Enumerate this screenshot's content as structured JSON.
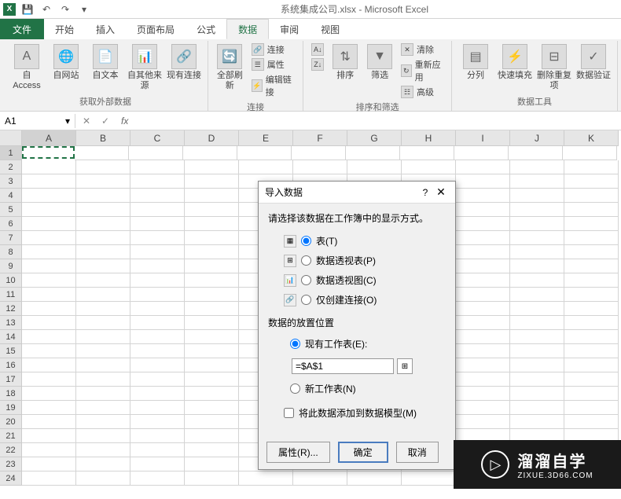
{
  "app": {
    "title": "系统集成公司.xlsx - Microsoft Excel"
  },
  "tabs": {
    "file": "文件",
    "home": "开始",
    "insert": "插入",
    "pagelayout": "页面布局",
    "formulas": "公式",
    "data": "数据",
    "review": "审阅",
    "view": "视图"
  },
  "ribbon": {
    "get_external": {
      "access": "自 Access",
      "web": "自网站",
      "text": "自文本",
      "other": "自其他来源",
      "existing": "现有连接",
      "label": "获取外部数据"
    },
    "connections": {
      "refresh": "全部刷新",
      "conn": "连接",
      "properties": "属性",
      "edit_links": "编辑链接",
      "label": "连接"
    },
    "sort_filter": {
      "sort": "排序",
      "filter": "筛选",
      "clear": "清除",
      "reapply": "重新应用",
      "advanced": "高级",
      "label": "排序和筛选"
    },
    "data_tools": {
      "text_to_col": "分列",
      "flash_fill": "快速填充",
      "remove_dup": "删除重复项",
      "data_val": "数据验证",
      "label": "数据工具"
    }
  },
  "namebox": "A1",
  "columns": [
    "A",
    "B",
    "C",
    "D",
    "E",
    "F",
    "G",
    "H",
    "I",
    "J",
    "K"
  ],
  "rows": [
    "1",
    "2",
    "3",
    "4",
    "5",
    "6",
    "7",
    "8",
    "9",
    "10",
    "11",
    "12",
    "13",
    "14",
    "15",
    "16",
    "17",
    "18",
    "19",
    "20",
    "21",
    "22",
    "23",
    "24"
  ],
  "dialog": {
    "title": "导入数据",
    "display_label": "请选择该数据在工作簿中的显示方式。",
    "table": "表(T)",
    "pivot_table": "数据透视表(P)",
    "pivot_chart": "数据透视图(C)",
    "conn_only": "仅创建连接(O)",
    "location_label": "数据的放置位置",
    "existing_ws": "现有工作表(E):",
    "existing_ws_value": "=$A$1",
    "new_ws": "新工作表(N)",
    "add_model": "将此数据添加到数据模型(M)",
    "properties_btn": "属性(R)...",
    "ok": "确定",
    "cancel": "取消"
  },
  "watermark": {
    "main": "溜溜自学",
    "sub": "ZIXUE.3D66.COM"
  }
}
